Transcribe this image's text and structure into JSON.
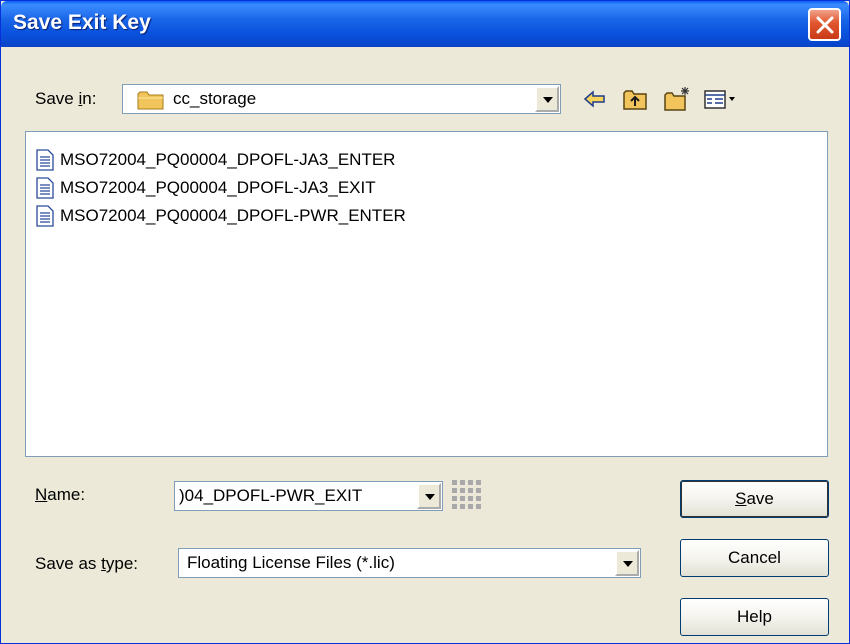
{
  "window": {
    "title": "Save Exit Key"
  },
  "icons": {
    "close": "close-icon",
    "folder": "folder-icon",
    "back": "back-arrow-icon",
    "up": "up-folder-icon",
    "new_folder": "new-folder-icon",
    "view": "view-menu-icon",
    "document": "document-icon",
    "grip": "grip-icon"
  },
  "save_in": {
    "label_pre": "Save ",
    "label_hot": "i",
    "label_post": "n:",
    "value": "cc_storage"
  },
  "files": [
    {
      "name": "MSO72004_PQ00004_DPOFL-JA3_ENTER"
    },
    {
      "name": "MSO72004_PQ00004_DPOFL-JA3_EXIT"
    },
    {
      "name": "MSO72004_PQ00004_DPOFL-PWR_ENTER"
    }
  ],
  "name_field": {
    "label_hot": "N",
    "label_post": "ame:",
    "value": ")04_DPOFL-PWR_EXIT"
  },
  "save_type": {
    "label_pre": "Save as ",
    "label_hot": "t",
    "label_post": "ype:",
    "value": "Floating License Files (*.lic)"
  },
  "buttons": {
    "save_hot": "S",
    "save_post": "ave",
    "cancel": "Cancel",
    "help": "Help"
  },
  "colors": {
    "titlebar": "#0A52DE",
    "dialog_bg": "#ECE9D8",
    "close": "#E0562F"
  }
}
